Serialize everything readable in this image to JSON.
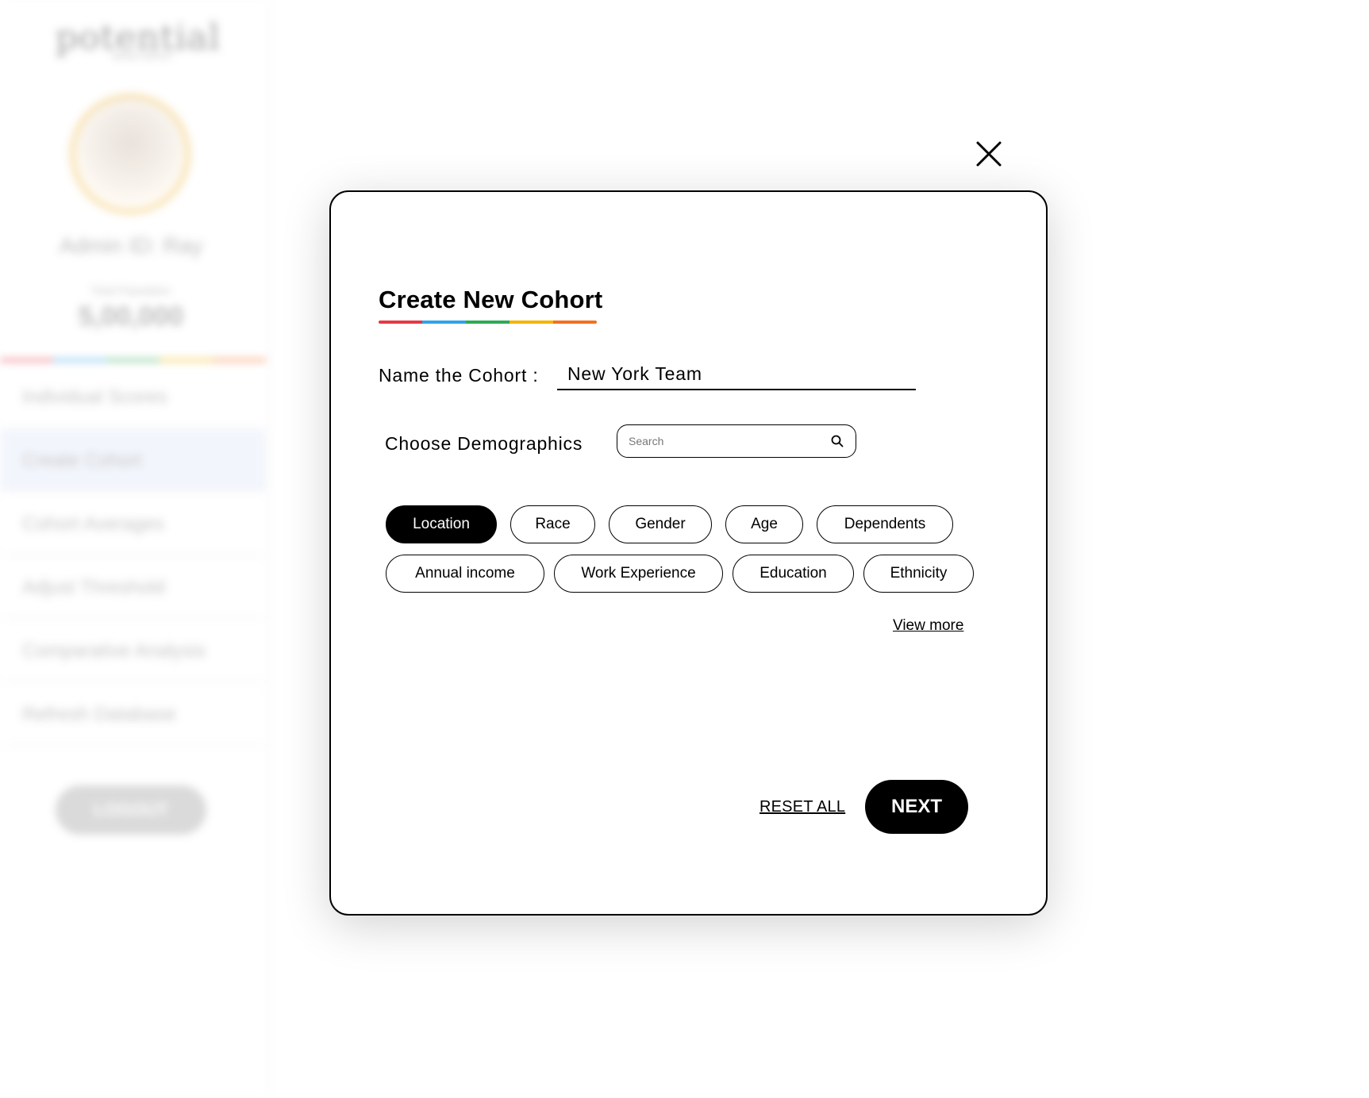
{
  "background": {
    "logo_text": "potential",
    "logo_subtext": "BRAND SUBTEXT",
    "admin_name": "Admin ID: Ray",
    "population_label": "Total Population",
    "population_value": "5,00,000",
    "nav_items": [
      {
        "label": "Individual Scores"
      },
      {
        "label": "Create Cohort"
      },
      {
        "label": "Cohort Averages"
      },
      {
        "label": "Adjust Threshold"
      },
      {
        "label": "Comparative Analysis"
      },
      {
        "label": "Refresh Database"
      }
    ],
    "logout_label": "LOGOUT"
  },
  "modal": {
    "title": "Create New Cohort",
    "name_label": "Name the Cohort :",
    "name_value": "New York Team",
    "demographics_label": "Choose Demographics",
    "search_placeholder": "Search",
    "chips": [
      {
        "label": "Location",
        "selected": true
      },
      {
        "label": "Race",
        "selected": false
      },
      {
        "label": "Gender",
        "selected": false
      },
      {
        "label": "Age",
        "selected": false
      },
      {
        "label": "Dependents",
        "selected": false
      },
      {
        "label": "Annual income",
        "selected": false
      },
      {
        "label": "Work Experience",
        "selected": false
      },
      {
        "label": "Education",
        "selected": false
      },
      {
        "label": "Ethnicity",
        "selected": false
      }
    ],
    "view_more_label": "View more",
    "reset_label": "RESET ALL",
    "next_label": "NEXT"
  },
  "icons": {
    "close": "close-icon",
    "search": "search-icon"
  },
  "colors": {
    "accent_red": "#e63946",
    "accent_blue": "#2fa4e7",
    "accent_green": "#2eaa57",
    "accent_yellow": "#f4b400",
    "accent_orange": "#f37021",
    "selected_chip_bg": "#000000"
  }
}
